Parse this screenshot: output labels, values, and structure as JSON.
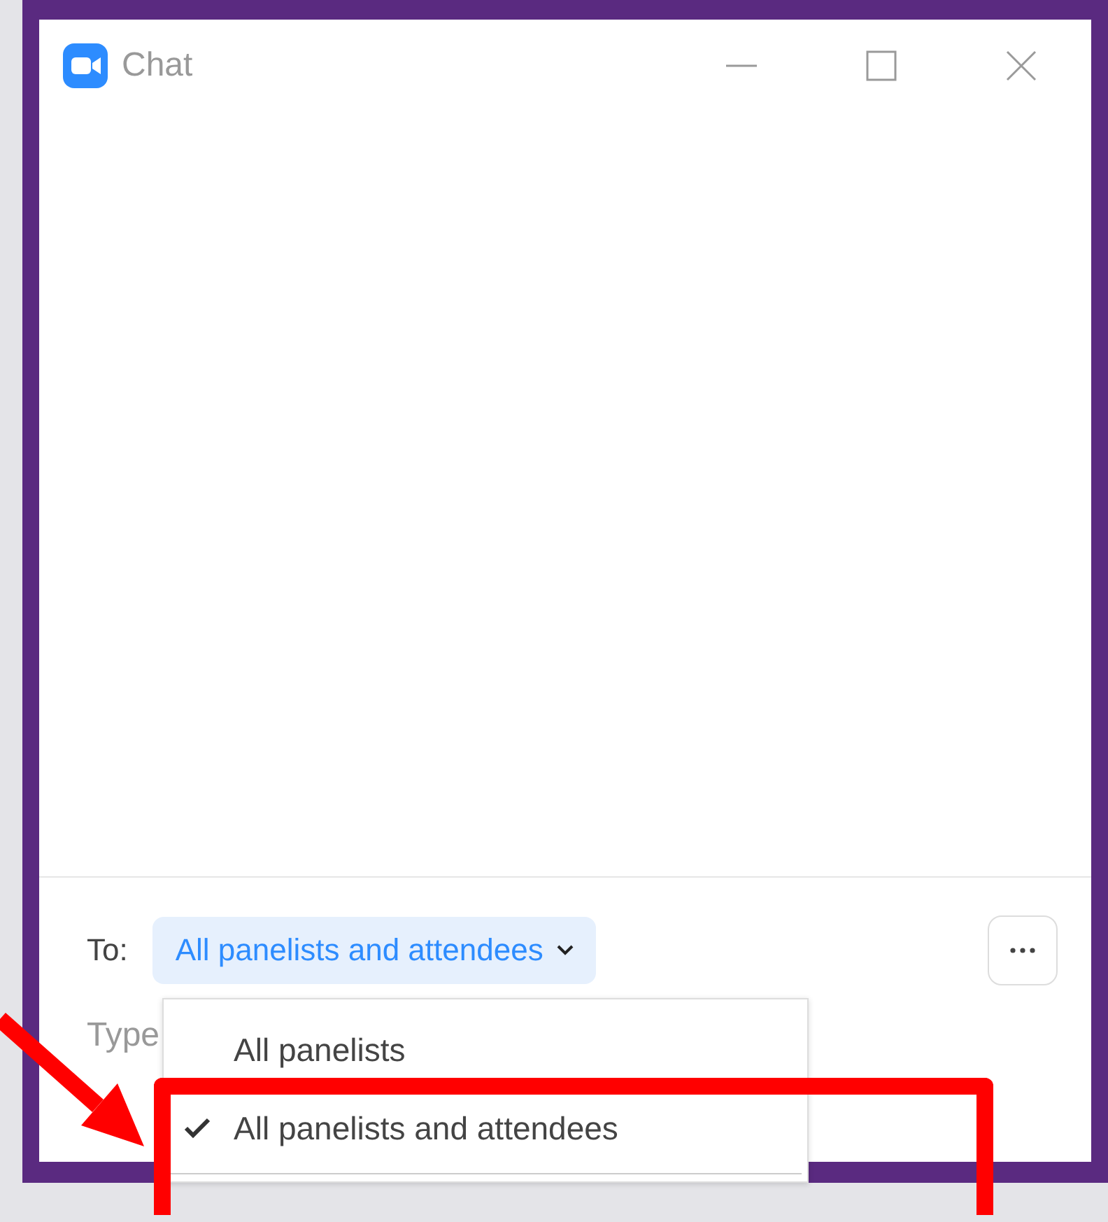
{
  "window": {
    "title": "Chat"
  },
  "composer": {
    "to_label": "To:",
    "recipient": "All panelists and attendees",
    "message_placeholder": "Type"
  },
  "recipient_menu": {
    "items": [
      {
        "label": "All panelists",
        "selected": false
      },
      {
        "label": "All panelists and attendees",
        "selected": true
      }
    ]
  }
}
